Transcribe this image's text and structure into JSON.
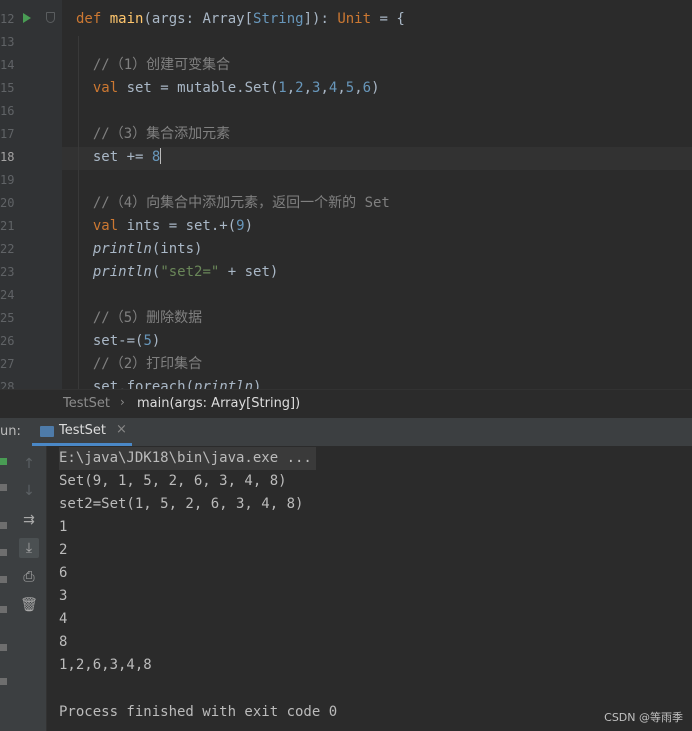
{
  "editor": {
    "lines": [
      {
        "n": "12",
        "html": "<span class='kw'>def </span><span class='fn'>main</span>(args: Array[<span class='ty'>String</span>]): <span class='kw'>Unit</span> = {"
      },
      {
        "n": "13",
        "html": ""
      },
      {
        "n": "14",
        "html": "  <span class='cm'>//（1）创建可变集合</span>"
      },
      {
        "n": "15",
        "html": "  <span class='kw'>val </span>set = mutable.Set(<span class='num'>1</span>,<span class='num'>2</span>,<span class='num'>3</span>,<span class='num'>4</span>,<span class='num'>5</span>,<span class='num'>6</span>)"
      },
      {
        "n": "16",
        "html": ""
      },
      {
        "n": "17",
        "html": "  <span class='cm'>//（3）集合添加元素</span>"
      },
      {
        "n": "18",
        "html": "  set += <span class='num'>8</span><span class='caret'></span>"
      },
      {
        "n": "19",
        "html": ""
      },
      {
        "n": "20",
        "html": "  <span class='cm'>//（4）向集合中添加元素，返回一个新的 Set</span>"
      },
      {
        "n": "21",
        "html": "  <span class='kw'>val </span>ints = set.+(<span class='num'>9</span>)"
      },
      {
        "n": "22",
        "html": "  <span class='it'>println</span>(ints)"
      },
      {
        "n": "23",
        "html": "  <span class='it'>println</span>(<span class='str'>\"set2=\"</span> + set)"
      },
      {
        "n": "24",
        "html": ""
      },
      {
        "n": "25",
        "html": "  <span class='cm'>//（5）删除数据</span>"
      },
      {
        "n": "26",
        "html": "  set-=(<span class='num'>5</span>)"
      },
      {
        "n": "27",
        "html": "  <span class='cm'>//（2）打印集合</span>"
      },
      {
        "n": "28",
        "html": "  set.foreach(<span class='it'>println</span>)"
      }
    ],
    "active_line": "18"
  },
  "breadcrumbs": {
    "file": "TestSet",
    "separator": "›",
    "method": "main(args: Array[String])"
  },
  "run_panel": {
    "label": "un:",
    "tab_label": "TestSet",
    "tab_close": "×"
  },
  "console": {
    "lines": [
      "E:\\java\\JDK18\\bin\\java.exe ...",
      "Set(9, 1, 5, 2, 6, 3, 4, 8)",
      "set2=Set(1, 5, 2, 6, 3, 4, 8)",
      "1",
      "2",
      "6",
      "3",
      "4",
      "8",
      "1,2,6,3,4,8",
      "",
      "Process finished with exit code 0"
    ]
  },
  "toolbar_icons": [
    "up-arrow-icon",
    "down-arrow-icon",
    "soft-wrap-icon",
    "scroll-to-end-icon",
    "print-icon",
    "trash-icon"
  ],
  "watermark": "CSDN @等雨季"
}
